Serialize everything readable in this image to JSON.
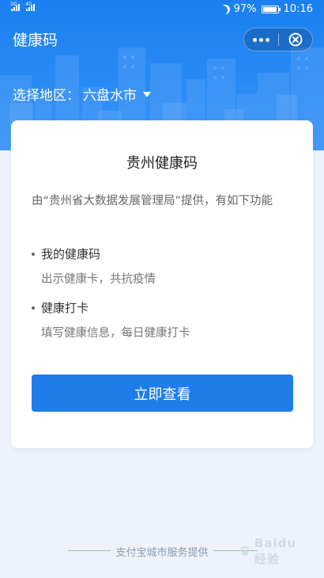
{
  "status_bar": {
    "signal_1": "3G",
    "signal_2": "4G",
    "battery_percent": "97%",
    "battery_level": 0.97,
    "time": "10:16"
  },
  "app": {
    "title": "健康码",
    "menu_icon": "more-dots-icon",
    "close_icon": "close-circle-icon"
  },
  "region": {
    "label": "选择地区：",
    "value": "六盘水市"
  },
  "card": {
    "title": "贵州健康码",
    "description": "由“贵州省大数据发展管理局”提供，有如下功能",
    "features": [
      {
        "title": "我的健康码",
        "subtitle": "出示健康卡，共抗疫情"
      },
      {
        "title": "健康打卡",
        "subtitle": "填写健康信息，每日健康打卡"
      }
    ],
    "button_label": "立即查看"
  },
  "footer": {
    "text": "支付宝城市服务提供"
  },
  "watermark": {
    "text": "Baidu 经验"
  },
  "colors": {
    "header_blue": "#1a7ff0",
    "button_blue": "#1e7de8",
    "background": "#eef3fb"
  }
}
